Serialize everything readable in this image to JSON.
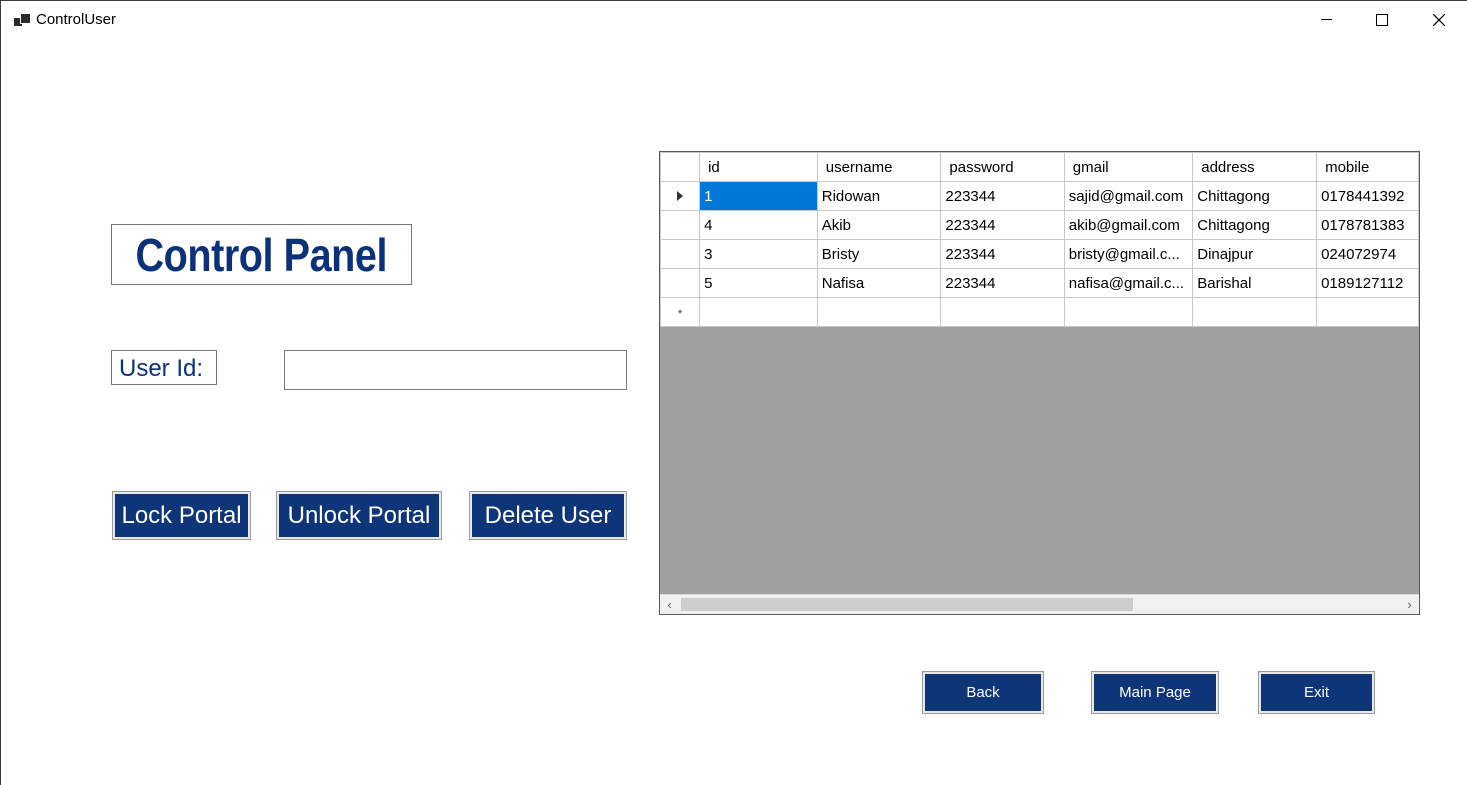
{
  "window": {
    "title": "ControlUser",
    "icon": "app-window-icon",
    "controls": {
      "minimize": "minimize-icon",
      "maximize": "maximize-icon",
      "close": "close-icon"
    }
  },
  "header": {
    "title": "Control Panel"
  },
  "form": {
    "user_id_label": "User Id:",
    "user_id_value": "",
    "buttons": {
      "lock": "Lock Portal",
      "unlock": "Unlock Portal",
      "delete": "Delete User"
    }
  },
  "grid": {
    "columns": [
      "id",
      "username",
      "password",
      "gmail",
      "address",
      "mobile"
    ],
    "rows": [
      [
        "1",
        "Ridowan",
        "223344",
        "sajid@gmail.com",
        "Chittagong",
        "0178441392"
      ],
      [
        "4",
        "Akib",
        "223344",
        "akib@gmail.com",
        "Chittagong",
        "0178781383"
      ],
      [
        "3",
        "Bristy",
        "223344",
        "bristy@gmail.c...",
        "Dinajpur",
        "024072974"
      ],
      [
        "5",
        "Nafisa",
        "223344",
        "nafisa@gmail.c...",
        "Barishal",
        "0189127112"
      ]
    ],
    "selected_row": 0,
    "new_row_marker": "*"
  },
  "nav": {
    "back": "Back",
    "main_page": "Main Page",
    "exit": "Exit"
  },
  "colors": {
    "accent": "#0d3578",
    "selection": "#0078d7",
    "grid_background": "#a0a0a0"
  }
}
